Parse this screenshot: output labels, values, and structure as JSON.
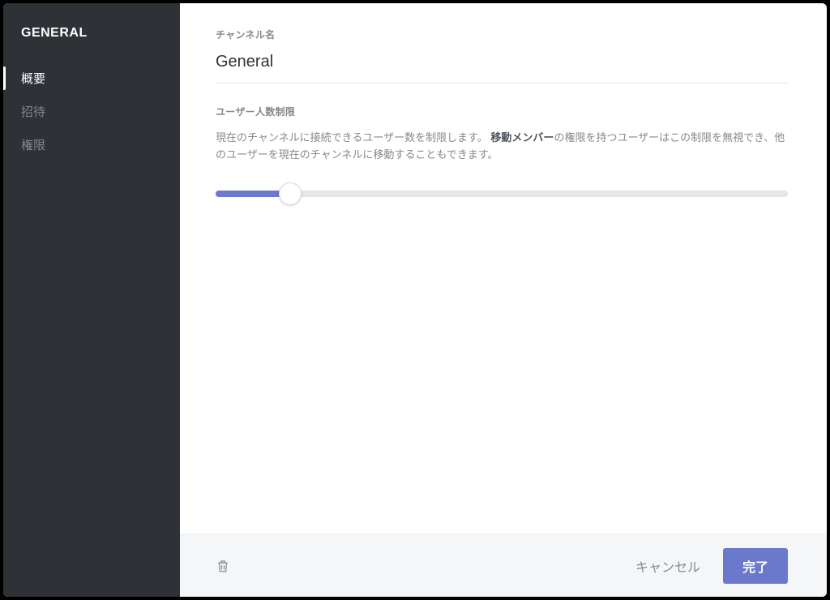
{
  "sidebar": {
    "title": "GENERAL",
    "items": [
      {
        "label": "概要",
        "active": true
      },
      {
        "label": "招待",
        "active": false
      },
      {
        "label": "権限",
        "active": false
      }
    ]
  },
  "sections": {
    "channel_name": {
      "label": "チャンネル名",
      "value": "General"
    },
    "user_limit": {
      "label": "ユーザー人数制限",
      "description_pre": "現在のチャンネルに接続できるユーザー数を制限します。",
      "description_strong": "移動メンバー",
      "description_post": "の権限を持つユーザーはこの制限を無視でき、他のユーザーを現在のチャンネルに移動することもできます。",
      "slider_percent": 13
    }
  },
  "footer": {
    "cancel": "キャンセル",
    "done": "完了"
  }
}
